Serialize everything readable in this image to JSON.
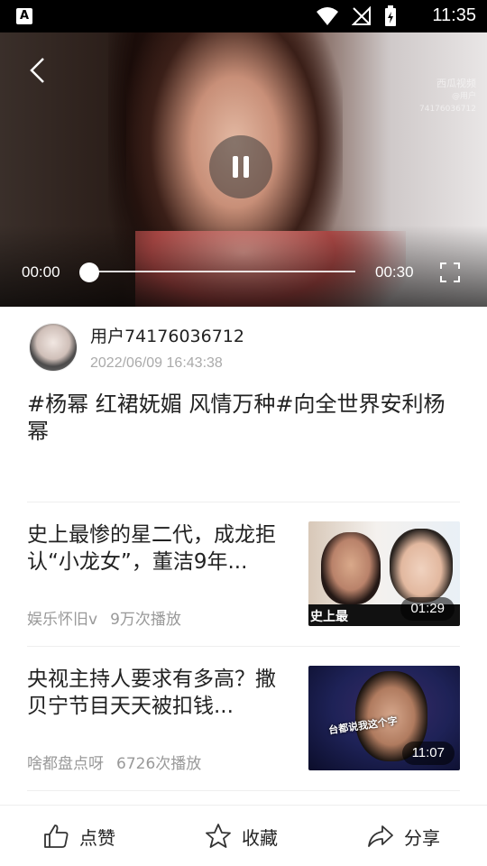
{
  "status_bar": {
    "app_icon_letter": "A",
    "time": "11:35"
  },
  "video": {
    "current_time": "00:00",
    "duration": "00:30",
    "progress": 0,
    "watermark_brand": "西瓜视频",
    "watermark_user": "@用户74176036712"
  },
  "author": {
    "username": "用户74176036712",
    "date": "2022/06/09 16:43:38"
  },
  "post": {
    "title": "#杨幂 红裙妩媚  风情万种#向全世界安利杨幂"
  },
  "related": [
    {
      "title": "史上最惨的星二代，成龙拒认“小龙女”，董洁9年...",
      "author": "娱乐怀旧v",
      "plays": "9万次播放",
      "duration": "01:29",
      "thumb_caption": "史上最"
    },
    {
      "title": "央视主持人要求有多高？撒贝宁节目天天被扣钱...",
      "author": "啥都盘点呀",
      "plays": "6726次播放",
      "duration": "11:07",
      "thumb_caption": "台都说我这个字"
    }
  ],
  "bottom_bar": {
    "like_label": "点赞",
    "favorite_label": "收藏",
    "share_label": "分享"
  }
}
